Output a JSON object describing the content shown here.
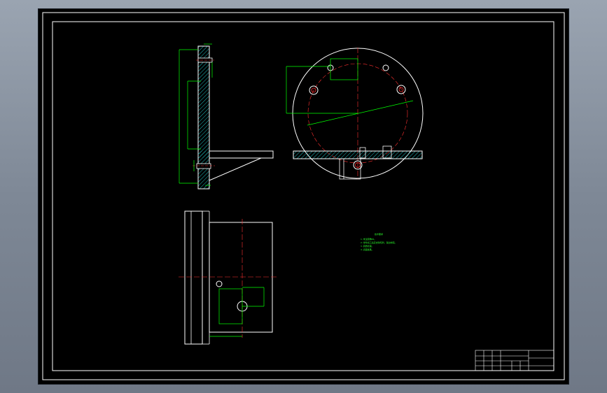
{
  "drawing": {
    "tech_notes": {
      "title": "技术要求",
      "lines": [
        "1.未注圆角R2。",
        "2.零件加工后应去除毛刺，锐边倒钝。",
        "3.调质处理。",
        "4.表面发黑。"
      ]
    },
    "colors": {
      "background": "#000000",
      "outline": "#ffffff",
      "dimension": "#00ff00",
      "centerline": "#ff0000",
      "hatch": "#00cccc",
      "viewport_bg_top": "#9aa4b1",
      "viewport_bg_bottom": "#6f7886"
    }
  }
}
